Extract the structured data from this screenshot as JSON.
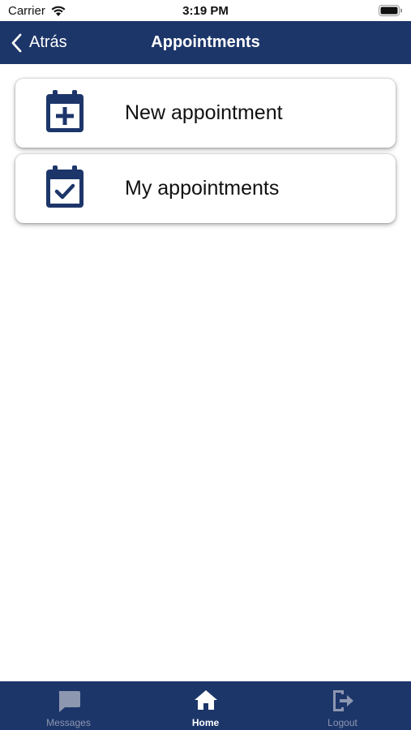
{
  "status_bar": {
    "carrier": "Carrier",
    "time": "3:19 PM",
    "wifi_icon": "wifi-icon",
    "battery_icon": "battery-icon"
  },
  "navbar": {
    "back_label": "Atrás",
    "title": "Appointments",
    "back_icon": "chevron-left-icon",
    "background_color": "#1d366a"
  },
  "menu": [
    {
      "label": "New appointment",
      "icon": "calendar-plus-icon"
    },
    {
      "label": "My appointments",
      "icon": "calendar-check-icon"
    }
  ],
  "tabbar": {
    "tabs": [
      {
        "label": "Messages",
        "icon": "chat-bubble-icon",
        "active": false
      },
      {
        "label": "Home",
        "icon": "home-icon",
        "active": true
      },
      {
        "label": "Logout",
        "icon": "logout-icon",
        "active": false
      }
    ],
    "active_color": "#ffffff",
    "inactive_color": "#8d97b0"
  }
}
